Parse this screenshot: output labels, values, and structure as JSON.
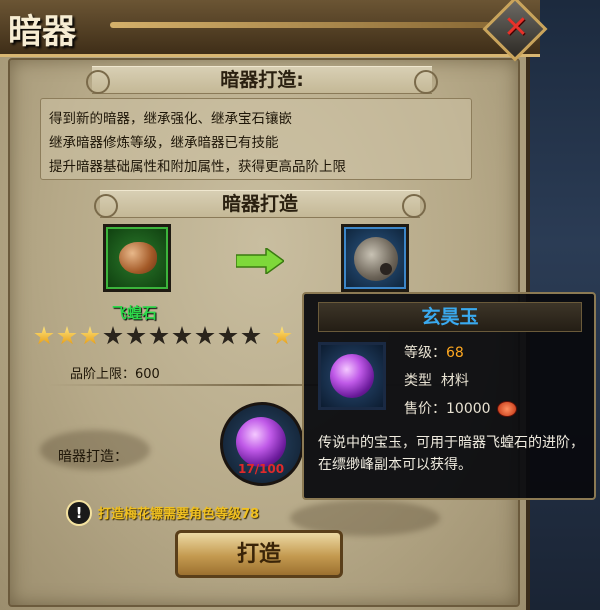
{
  "window": {
    "title": "暗器"
  },
  "intro": {
    "heading": "暗器打造:",
    "lines": [
      "得到新的暗器，继承强化、继承宝石镶嵌",
      "继承暗器修炼等级，继承暗器已有技能",
      "提升暗器基础属性和附加属性，获得更高品阶上限"
    ]
  },
  "forge": {
    "heading": "暗器打造",
    "source_item": {
      "name": "飞蝗石",
      "stars": 3,
      "max_stars": 10,
      "quality_color": "#2dd84a"
    },
    "target_item": {
      "stars": 1
    },
    "cap_label": "品阶上限：",
    "cap_value": "600",
    "material_label": "暗器打造：",
    "material_progress": "17/100",
    "warning": "打造梅花镖需要角色等级78",
    "craft_button": "打造"
  },
  "tooltip": {
    "name": "玄昊玉",
    "level_label": "等级：",
    "level_value": "68",
    "type_label": "类型",
    "type_value": "材料",
    "price_label": "售价：",
    "price_value": "10000",
    "description": "传说中的宝玉，可用于暗器飞蝗石的进阶，在缥缈峰副本可以获得。",
    "name_color": "#3aaaf0"
  },
  "icons": {
    "close": "close-icon",
    "arrow": "arrow-right-icon",
    "warning": "exclamation-icon",
    "coin": "coin-icon"
  }
}
